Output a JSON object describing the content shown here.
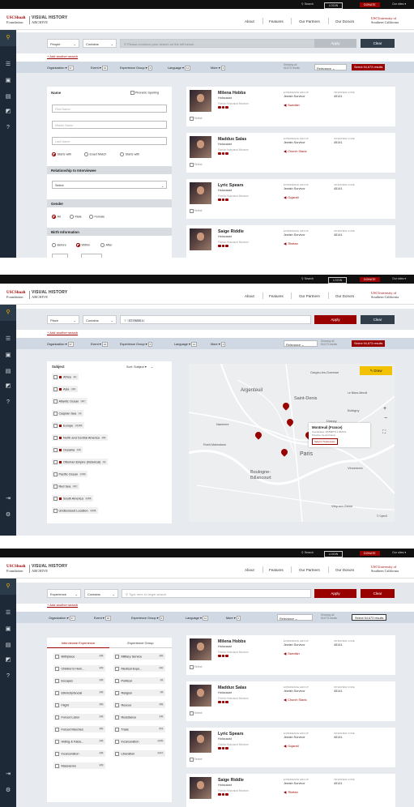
{
  "topbar": {
    "search": "Search",
    "login": "LOGIN",
    "donate": "DONATE",
    "our_sites": "Our sites ▾"
  },
  "header": {
    "logo_usc": "USCShoah",
    "logo_foundation": "Foundation",
    "logo_vh": "VISUAL HISTORY",
    "logo_archive": "ARCHIVE",
    "nav": [
      "About",
      "Features",
      "Our Partners",
      "Our Donors"
    ],
    "usc_univ": "USCUniversity of",
    "usc_socal": "Southern California"
  },
  "searchbars": [
    {
      "category": "People",
      "operator": "Contains",
      "placeholder": "Please construct your search on the left below.",
      "apply": "Apply",
      "clear": "Clear"
    },
    {
      "category": "Place",
      "operator": "Contains",
      "tag": "ST. PARIS",
      "apply": "Apply",
      "clear": "Clear"
    },
    {
      "category": "Experience",
      "operator": "Contains",
      "placeholder": "Type here to begin search",
      "apply": "Apply",
      "clear": "Clear"
    }
  ],
  "add_search": "+ Add another search",
  "filters": [
    {
      "label": "Organization",
      "count": "37"
    },
    {
      "label": "Event",
      "count": "34"
    },
    {
      "label": "Experience Group",
      "count": "6"
    },
    {
      "label": "Language",
      "count": "12"
    },
    {
      "label": "More",
      "count": "4"
    }
  ],
  "relevance": "Relevance",
  "showing": "Showing all",
  "showing_count": "54,673 results",
  "select_results": "Select 54,673 results",
  "people_form": {
    "name_title": "Name",
    "phonetic": "Phonetic Spelling",
    "first_name": "First Name",
    "middle_name": "Middle Name",
    "last_name": "Last Name",
    "name_opts": [
      "Starts with",
      "Exact Match",
      "Starts with"
    ],
    "relationship": "Relationship to Interviewee",
    "select": "Select",
    "gender": "Gender",
    "gender_opts": [
      "All",
      "Male",
      "Female"
    ],
    "birth": "Birth Information",
    "birth_opts": [
      "Before",
      "Within",
      "After"
    ]
  },
  "results": [
    {
      "name": "Milena Hobbs",
      "event": "Holocaust",
      "museum": "Florida Holocaust Museum",
      "exp_label": "EXPERIENCE GROUP",
      "exp": "Jewish Survivor",
      "code_label": "INTERVIEW CODE",
      "code": "45141",
      "lang": "Swedish",
      "select": "Select"
    },
    {
      "name": "Maddux Salas",
      "event": "Holocaust",
      "museum": "Florida Holocaust Museum",
      "exp_label": "EXPERIENCE GROUP",
      "exp": "Jewish Survivor",
      "code_label": "INTERVIEW CODE",
      "code": "45141",
      "lang": "Church Slavic",
      "select": "Select"
    },
    {
      "name": "Lyric Spears",
      "event": "Holocaust",
      "museum": "Florida Holocaust Museum",
      "exp_label": "EXPERIENCE GROUP",
      "exp": "Jewish Survivor",
      "code_label": "INTERVIEW CODE",
      "code": "45141",
      "lang": "Gujarati",
      "select": "Select"
    },
    {
      "name": "Saige Riddle",
      "event": "Holocaust",
      "museum": "Florida Holocaust Museum",
      "exp_label": "EXPERIENCE GROUP",
      "exp": "Jewish Survivor",
      "code_label": "INTERVIEW CODE",
      "code": "45141",
      "lang": "Tibetan",
      "select": "Select"
    }
  ],
  "subject": {
    "title": "Subject",
    "sort": "Sort: Subject",
    "items": [
      {
        "label": "Africa",
        "count": "10",
        "marked": true
      },
      {
        "label": "Asia",
        "count": "190",
        "marked": true
      },
      {
        "label": "Atlantic Ocean",
        "count": "467",
        "marked": false
      },
      {
        "label": "Caspian Sea",
        "count": "12",
        "marked": false
      },
      {
        "label": "Europe",
        "count": "13,082",
        "marked": true
      },
      {
        "label": "North and Central America",
        "count": "190",
        "marked": true
      },
      {
        "label": "Oceania",
        "count": "120",
        "marked": true
      },
      {
        "label": "Ottoman Empire (historical)",
        "count": "91",
        "marked": true
      },
      {
        "label": "Pacific Ocean",
        "count": "2,039",
        "marked": false
      },
      {
        "label": "Red Sea",
        "count": "197",
        "marked": false
      },
      {
        "label": "South America",
        "count": "2,039",
        "marked": true
      },
      {
        "label": "Undisclosed Location",
        "count": "2,039",
        "marked": false
      }
    ]
  },
  "map": {
    "draw": "Draw",
    "labels": [
      "Gargeu-les-Gonesse",
      "Argenteuil",
      "Saint-Denis",
      "Bobigny",
      "Drancy",
      "Nanterre",
      "Rueil-Malmaison",
      "Paris",
      "Boulogne-Billancourt",
      "Vincennes",
      "Vitry-sur-Seine",
      "Le Blanc-Mesnil"
    ],
    "popup_title": "Montreuil (France)",
    "popup_coords": "Coordinates: 48.8588°N 2.3522°E",
    "popup_province": "Province: Ile-de-France",
    "popup_btn": "Select 2 Testimonies",
    "credit": "© OpenS"
  },
  "experience": {
    "tabs": [
      "Interviewee Experience",
      "Experience Group"
    ],
    "items": [
      {
        "label": "Birthplace",
        "count": "145"
      },
      {
        "label": "Military Service",
        "count": "192"
      },
      {
        "label": "Children's Hom...",
        "count": "145"
      },
      {
        "label": "Medical Expe...",
        "count": "192"
      },
      {
        "label": "Escapes",
        "count": "145"
      },
      {
        "label": "Political",
        "count": "18"
      },
      {
        "label": "Ethnicity/Social",
        "count": "145"
      },
      {
        "label": "Religion",
        "count": "28"
      },
      {
        "label": "Flight",
        "count": "156"
      },
      {
        "label": "Rescue",
        "count": "159"
      },
      {
        "label": "Forced Labor",
        "count": "145"
      },
      {
        "label": "Resistance",
        "count": "145"
      },
      {
        "label": "Forced Marches",
        "count": "156"
      },
      {
        "label": "Trials",
        "count": "874"
      },
      {
        "label": "Hiding & False...",
        "count": "145"
      },
      {
        "label": "Incarceration",
        "count": "1,095"
      },
      {
        "label": "Incarceration",
        "count": "145"
      },
      {
        "label": "Liberation",
        "count": "1,017"
      },
      {
        "label": "Massacres",
        "count": "145"
      }
    ]
  }
}
